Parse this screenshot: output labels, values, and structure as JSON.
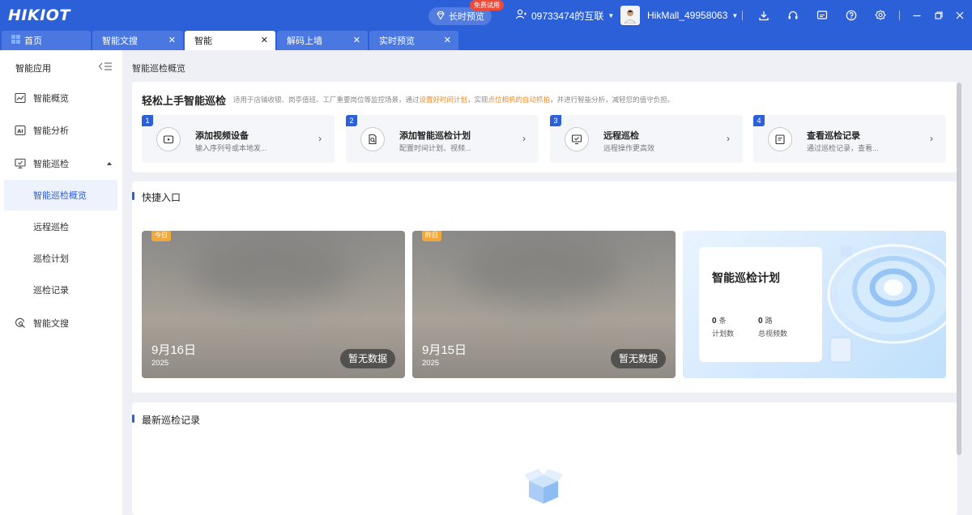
{
  "app": {
    "logo": "HIKIOT",
    "trial_badge": "免费试用",
    "long_preview": "长时预览",
    "org": "09733474的互联",
    "username": "HikMall_49958063"
  },
  "tabs": [
    {
      "label": "首页"
    },
    {
      "label": "智能文搜"
    },
    {
      "label": "智能"
    },
    {
      "label": "解码上墙"
    },
    {
      "label": "实时预览"
    }
  ],
  "sidebar": {
    "title": "智能应用",
    "items": [
      {
        "label": "智能概览"
      },
      {
        "label": "智能分析"
      },
      {
        "label": "智能巡检"
      },
      {
        "label": "智能巡检概览"
      },
      {
        "label": "远程巡检"
      },
      {
        "label": "巡检计划"
      },
      {
        "label": "巡检记录"
      },
      {
        "label": "智能文搜"
      }
    ]
  },
  "main": {
    "breadcrumb": "智能巡检概览",
    "guide": {
      "title": "轻松上手智能巡检",
      "desc_1": "适用于店铺收银、岗亭值班、工厂重要岗位等监控场景，通过",
      "desc_hl_1": "设置好时间计划",
      "desc_2": "，实现",
      "desc_hl_2": "点位相机的自动抓拍",
      "desc_3": "，并进行智能分析，减轻您的值守负担。",
      "steps": [
        {
          "num": "1",
          "title": "添加视频设备",
          "desc": "输入序列号或本地发..."
        },
        {
          "num": "2",
          "title": "添加智能巡检计划",
          "desc": "配置时间计划、视频..."
        },
        {
          "num": "3",
          "title": "远程巡检",
          "desc": "远程操作更高效"
        },
        {
          "num": "4",
          "title": "查看巡检记录",
          "desc": "通过巡检记录，查看..."
        }
      ]
    },
    "quick": {
      "title": "快捷入口",
      "snapshots": [
        {
          "tag": "今日",
          "date": "9月16日",
          "year": "2025",
          "status": "暂无数据"
        },
        {
          "tag": "昨日",
          "date": "9月15日",
          "year": "2025",
          "status": "暂无数据"
        }
      ],
      "plan": {
        "title": "智能巡检计划",
        "count": "0",
        "count_unit": "条",
        "count_label": "计划数",
        "channels": "0",
        "channels_unit": "路",
        "channels_label": "总视频数"
      }
    },
    "records": {
      "title": "最新巡检记录"
    }
  },
  "colors": {
    "brand": "#2c60d8",
    "highlight": "#f08a24",
    "trial_badge": "#f04a3a"
  }
}
